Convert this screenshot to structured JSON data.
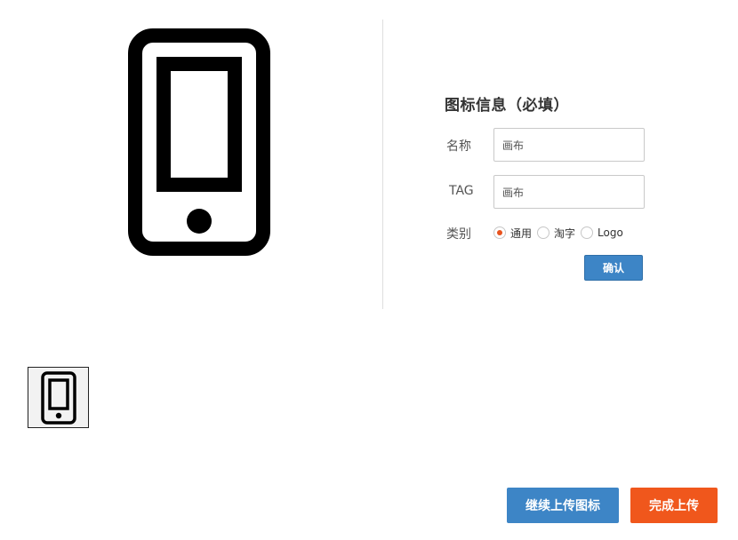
{
  "preview": {
    "icon": "mobile-phone-icon"
  },
  "form": {
    "title": "图标信息（必填）",
    "name_label": "名称",
    "name_value": "画布",
    "tag_label": "TAG",
    "tag_value": "画布",
    "category_label": "类别",
    "categories": [
      {
        "label": "通用",
        "checked": true
      },
      {
        "label": "淘字",
        "checked": false
      },
      {
        "label": "Logo",
        "checked": false
      }
    ],
    "confirm_label": "确认"
  },
  "thumbnail": {
    "icon": "mobile-phone-icon"
  },
  "actions": {
    "continue_label": "继续上传图标",
    "finish_label": "完成上传"
  },
  "colors": {
    "primary": "#3d85c6",
    "accent": "#f0571c",
    "radio_checked": "#e8531e"
  }
}
